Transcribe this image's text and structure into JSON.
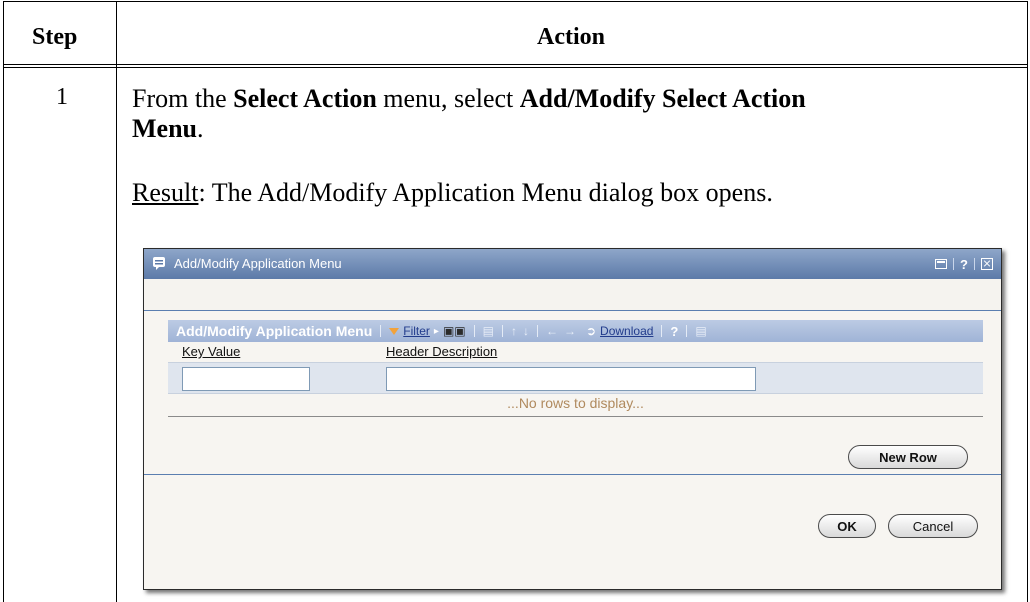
{
  "table": {
    "col_step": "Step",
    "col_action": "Action",
    "row_step_number": "1"
  },
  "instruction": {
    "prefix": "From the ",
    "menu_name": "Select Action",
    "middle": " menu, select ",
    "option_line1": "Add/Modify Select Action",
    "option_line2": "Menu",
    "suffix": "."
  },
  "result": {
    "label": "Result",
    "text": ": The Add/Modify Application Menu dialog box opens."
  },
  "dialog": {
    "title": "Add/Modify Application Menu",
    "title_icons": [
      "panel-icon",
      "help-icon",
      "close-icon"
    ],
    "grid": {
      "title": "Add/Modify Application Menu",
      "filter_label": "Filter",
      "download_label": "Download",
      "help_label": "?",
      "columns": [
        "Key Value",
        "Header Description"
      ],
      "empty_message": "...No rows to display...",
      "new_row_label": "New Row"
    },
    "ok_label": "OK",
    "cancel_label": "Cancel"
  },
  "colors": {
    "title_bar": "#6f8bb7",
    "grid_toolbar": "#a9bcdd",
    "link": "#223c8c",
    "empty_text": "#b08a5e"
  }
}
